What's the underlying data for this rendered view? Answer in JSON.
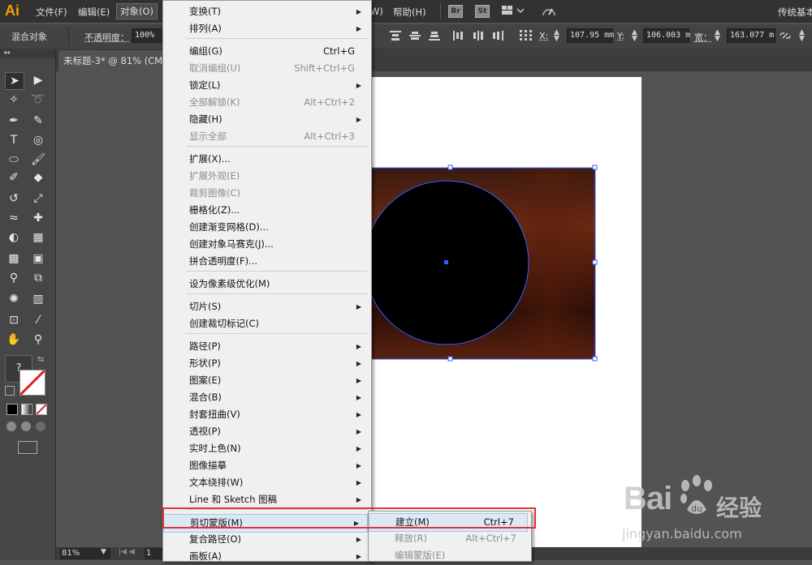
{
  "menubar": {
    "logo": "Ai",
    "items": [
      "文件(F)",
      "编辑(E)",
      "对象(O)"
    ],
    "right_items": [
      "W)",
      "帮助(H)"
    ],
    "bridge_label": "Br",
    "stock_label": "St",
    "workspace": "传统基本"
  },
  "control_bar": {
    "selection_type": "混合对象",
    "opacity_label": "不透明度：",
    "opacity_value": "100%",
    "x_label": "X:",
    "x_value": "107.95 mm",
    "y_label": "Y:",
    "y_value": "106.003 m",
    "w_label": "宽：",
    "w_value": "163.077 m"
  },
  "document": {
    "tab_title": "未标题-3* @ 81% (CM",
    "zoom": "81%",
    "page": "1"
  },
  "tools": {
    "fill_stroke_help": "?"
  },
  "object_menu": {
    "items": [
      {
        "label": "变换(T)",
        "shortcut": "",
        "submenu": true,
        "disabled": false
      },
      {
        "label": "排列(A)",
        "shortcut": "",
        "submenu": true,
        "disabled": false
      },
      {
        "label": "编组(G)",
        "shortcut": "Ctrl+G",
        "submenu": false,
        "disabled": false
      },
      {
        "label": "取消编组(U)",
        "shortcut": "Shift+Ctrl+G",
        "submenu": false,
        "disabled": true
      },
      {
        "label": "锁定(L)",
        "shortcut": "",
        "submenu": true,
        "disabled": false
      },
      {
        "label": "全部解锁(K)",
        "shortcut": "Alt+Ctrl+2",
        "submenu": false,
        "disabled": true
      },
      {
        "label": "隐藏(H)",
        "shortcut": "",
        "submenu": true,
        "disabled": false
      },
      {
        "label": "显示全部",
        "shortcut": "Alt+Ctrl+3",
        "submenu": false,
        "disabled": true
      },
      {
        "label": "扩展(X)...",
        "shortcut": "",
        "submenu": false,
        "disabled": false
      },
      {
        "label": "扩展外观(E)",
        "shortcut": "",
        "submenu": false,
        "disabled": true
      },
      {
        "label": "裁剪图像(C)",
        "shortcut": "",
        "submenu": false,
        "disabled": true
      },
      {
        "label": "栅格化(Z)...",
        "shortcut": "",
        "submenu": false,
        "disabled": false
      },
      {
        "label": "创建渐变网格(D)...",
        "shortcut": "",
        "submenu": false,
        "disabled": false
      },
      {
        "label": "创建对象马赛克(J)...",
        "shortcut": "",
        "submenu": false,
        "disabled": false
      },
      {
        "label": "拼合透明度(F)...",
        "shortcut": "",
        "submenu": false,
        "disabled": false
      },
      {
        "label": "设为像素级优化(M)",
        "shortcut": "",
        "submenu": false,
        "disabled": false
      },
      {
        "label": "切片(S)",
        "shortcut": "",
        "submenu": true,
        "disabled": false
      },
      {
        "label": "创建裁切标记(C)",
        "shortcut": "",
        "submenu": false,
        "disabled": false
      },
      {
        "label": "路径(P)",
        "shortcut": "",
        "submenu": true,
        "disabled": false
      },
      {
        "label": "形状(P)",
        "shortcut": "",
        "submenu": true,
        "disabled": false
      },
      {
        "label": "图案(E)",
        "shortcut": "",
        "submenu": true,
        "disabled": false
      },
      {
        "label": "混合(B)",
        "shortcut": "",
        "submenu": true,
        "disabled": false
      },
      {
        "label": "封套扭曲(V)",
        "shortcut": "",
        "submenu": true,
        "disabled": false
      },
      {
        "label": "透视(P)",
        "shortcut": "",
        "submenu": true,
        "disabled": false
      },
      {
        "label": "实时上色(N)",
        "shortcut": "",
        "submenu": true,
        "disabled": false
      },
      {
        "label": "图像描摹",
        "shortcut": "",
        "submenu": true,
        "disabled": false
      },
      {
        "label": "文本绕排(W)",
        "shortcut": "",
        "submenu": true,
        "disabled": false
      },
      {
        "label": "Line 和 Sketch 图稿",
        "shortcut": "",
        "submenu": true,
        "disabled": false
      },
      {
        "label": "剪切蒙版(M)",
        "shortcut": "",
        "submenu": true,
        "disabled": false,
        "highlighted": true
      },
      {
        "label": "复合路径(O)",
        "shortcut": "",
        "submenu": true,
        "disabled": false
      },
      {
        "label": "画板(A)",
        "shortcut": "",
        "submenu": true,
        "disabled": false
      }
    ]
  },
  "clipping_submenu": {
    "items": [
      {
        "label": "建立(M)",
        "shortcut": "Ctrl+7",
        "disabled": false,
        "highlighted": true
      },
      {
        "label": "释放(R)",
        "shortcut": "Alt+Ctrl+7",
        "disabled": true
      },
      {
        "label": "编辑蒙版(E)",
        "shortcut": "",
        "disabled": true
      }
    ]
  },
  "watermark": {
    "brand_prefix": "Bai",
    "brand_suffix": "经验",
    "url": "jingyan.baidu.com"
  },
  "colors": {
    "accent_red": "#e03535",
    "selection_blue": "#3a5dff",
    "logo_orange": "#ff9a00"
  }
}
